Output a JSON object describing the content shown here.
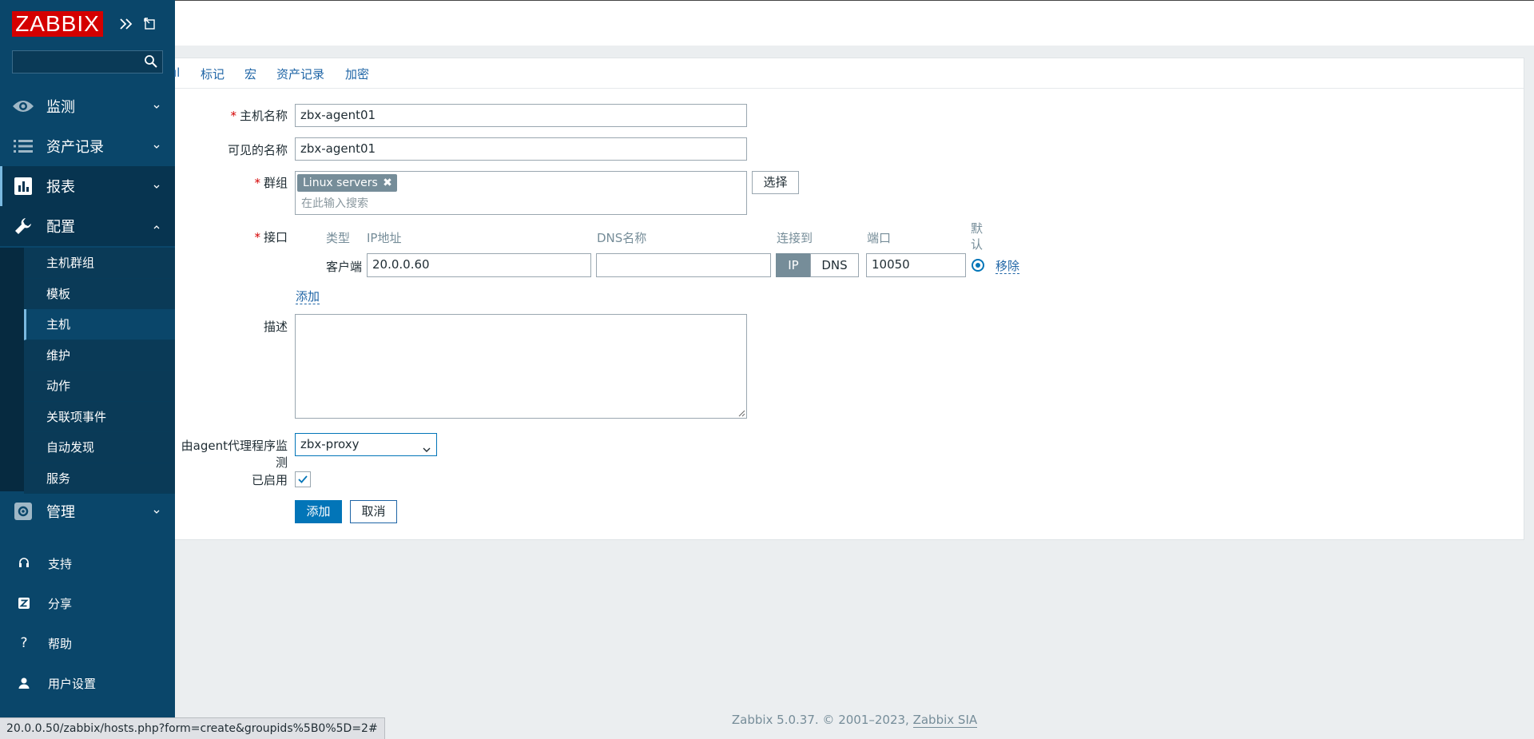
{
  "sidebar": {
    "logo": "ZABBIX",
    "search": {
      "value": "",
      "placeholder": ""
    },
    "menu": [
      {
        "label": "监测",
        "icon": "eye-icon"
      },
      {
        "label": "资产记录",
        "icon": "list-icon"
      },
      {
        "label": "报表",
        "icon": "bar-chart-icon"
      },
      {
        "label": "配置",
        "icon": "wrench-icon"
      }
    ],
    "config_submenu": [
      "主机群组",
      "模板",
      "主机",
      "维护",
      "动作",
      "关联项事件",
      "自动发现",
      "服务"
    ],
    "admin": {
      "label": "管理",
      "icon": "gear-icon"
    },
    "bottom": [
      {
        "label": "支持",
        "icon": "headset-icon"
      },
      {
        "label": "分享",
        "icon": "share-z-icon"
      },
      {
        "label": "帮助",
        "icon": "question-icon"
      },
      {
        "label": "用户设置",
        "icon": "user-icon"
      }
    ]
  },
  "tabs": [
    "ıl",
    "标记",
    "宏",
    "资产记录",
    "加密"
  ],
  "form": {
    "host_name": {
      "label": "主机名称",
      "value": "zbx-agent01"
    },
    "visible_name": {
      "label": "可见的名称",
      "value": "zbx-agent01"
    },
    "groups": {
      "label": "群组",
      "tag": "Linux servers",
      "placeholder": "在此输入搜索",
      "select_button": "选择"
    },
    "interfaces": {
      "label": "接口",
      "headers": {
        "type": "类型",
        "ip": "IP地址",
        "dns": "DNS名称",
        "connect": "连接到",
        "port": "端口",
        "default": "默认"
      },
      "row": {
        "type": "客户端",
        "ip": "20.0.0.60",
        "dns": "",
        "connect_ip": "IP",
        "connect_dns": "DNS",
        "port": "10050",
        "remove": "移除"
      },
      "add": "添加"
    },
    "description": {
      "label": "描述",
      "value": ""
    },
    "proxy": {
      "label": "由agent代理程序监测",
      "value": "zbx-proxy"
    },
    "enabled": {
      "label": "已启用"
    },
    "add_button": "添加",
    "cancel_button": "取消"
  },
  "footer": {
    "text": "Zabbix 5.0.37. © 2001–2023, ",
    "link": "Zabbix SIA"
  },
  "status_bar": "20.0.0.50/zabbix/hosts.php?form=create&groupids%5B0%5D=2#"
}
